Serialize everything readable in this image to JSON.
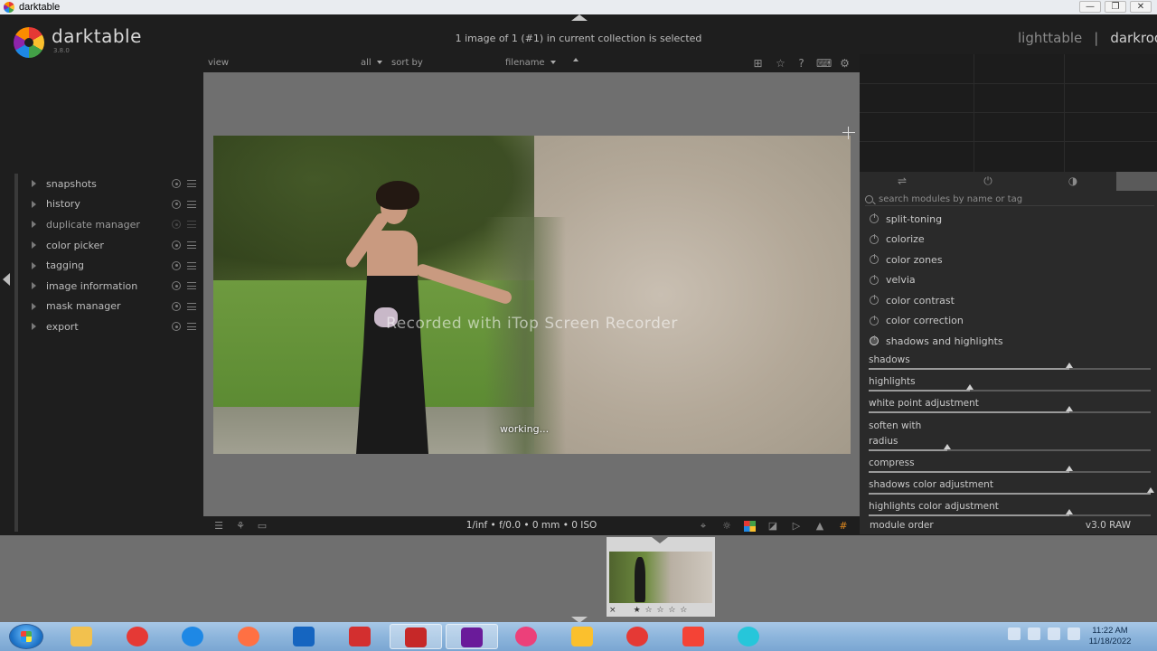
{
  "window": {
    "title": "darktable",
    "minimize": "—",
    "restore": "❐",
    "close": "✕"
  },
  "header": {
    "brand": "darktable",
    "version": "3.8.0",
    "collection_status": "1 image of 1 (#1) in current collection is selected",
    "views": [
      {
        "label": "lighttable",
        "active": false
      },
      {
        "label": "darkroom",
        "active": true
      }
    ],
    "separator": "|"
  },
  "center_toolbar": {
    "view_label": "view",
    "filter_value": "all",
    "sort_label": "sort by",
    "sort_value": "filename",
    "icons": [
      "grouping-icon",
      "star-icon",
      "help-icon",
      "keyboard-icon",
      "gear-icon"
    ],
    "icon_glyphs": [
      "⊞",
      "☆",
      "?",
      "⌨",
      "⚙"
    ]
  },
  "left_modules": [
    {
      "label": "snapshots",
      "dim": false
    },
    {
      "label": "history",
      "dim": false
    },
    {
      "label": "duplicate manager",
      "dim": true
    },
    {
      "label": "color picker",
      "dim": false
    },
    {
      "label": "tagging",
      "dim": false
    },
    {
      "label": "image information",
      "dim": false
    },
    {
      "label": "mask manager",
      "dim": false
    },
    {
      "label": "export",
      "dim": false
    }
  ],
  "image": {
    "watermark": "Recorded with iTop Screen Recorder",
    "working": "working..."
  },
  "bottom_toolbar": {
    "exif": "1/inf • f/0.0 • 0 mm • 0 ISO"
  },
  "right_panel": {
    "search_placeholder": "search modules by name or tag",
    "modules": [
      {
        "label": "split-toning",
        "active": false
      },
      {
        "label": "colorize",
        "active": false
      },
      {
        "label": "color zones",
        "active": false
      },
      {
        "label": "velvia",
        "active": false
      },
      {
        "label": "color contrast",
        "active": false
      },
      {
        "label": "color correction",
        "active": false
      },
      {
        "label": "shadows and highlights",
        "active": true
      }
    ],
    "sliders": [
      {
        "label": "shadows",
        "value": 0.71
      },
      {
        "label": "highlights",
        "value": 0.36
      },
      {
        "label": "white point adjustment",
        "value": 0.71
      },
      {
        "label": "soften with",
        "value": null
      },
      {
        "label": "radius",
        "value": 0.28
      },
      {
        "label": "compress",
        "value": 0.71
      },
      {
        "label": "shadows color adjustment",
        "value": 1.0
      },
      {
        "label": "highlights color adjustment",
        "value": 0.71
      }
    ],
    "module_order_label": "module order",
    "module_order_value": "v3.0 RAW"
  },
  "filmstrip": {
    "close": "×",
    "stars": "★ ☆ ☆ ☆ ☆"
  },
  "taskbar": {
    "apps": [
      {
        "name": "file-explorer-icon",
        "color": "#f2c14e"
      },
      {
        "name": "chrome-icon",
        "color": "#e53935"
      },
      {
        "name": "edge-icon",
        "color": "#1e88e5"
      },
      {
        "name": "firefox-icon",
        "color": "#ff7043"
      },
      {
        "name": "maxthon-icon",
        "color": "#1565c0"
      },
      {
        "name": "vivaldi-icon",
        "color": "#d32f2f"
      },
      {
        "name": "screen-recorder-icon",
        "color": "#c62828"
      },
      {
        "name": "darktable-icon",
        "color": "#6a1b9a"
      },
      {
        "name": "opera-gx-icon",
        "color": "#ec407a"
      },
      {
        "name": "7-star-icon",
        "color": "#fbc02d"
      },
      {
        "name": "opera-icon",
        "color": "#e53935"
      },
      {
        "name": "yandex-icon",
        "color": "#f44336"
      },
      {
        "name": "aloha-icon",
        "color": "#26c6da"
      }
    ],
    "time": "11:22 AM",
    "date": "11/18/2022"
  }
}
